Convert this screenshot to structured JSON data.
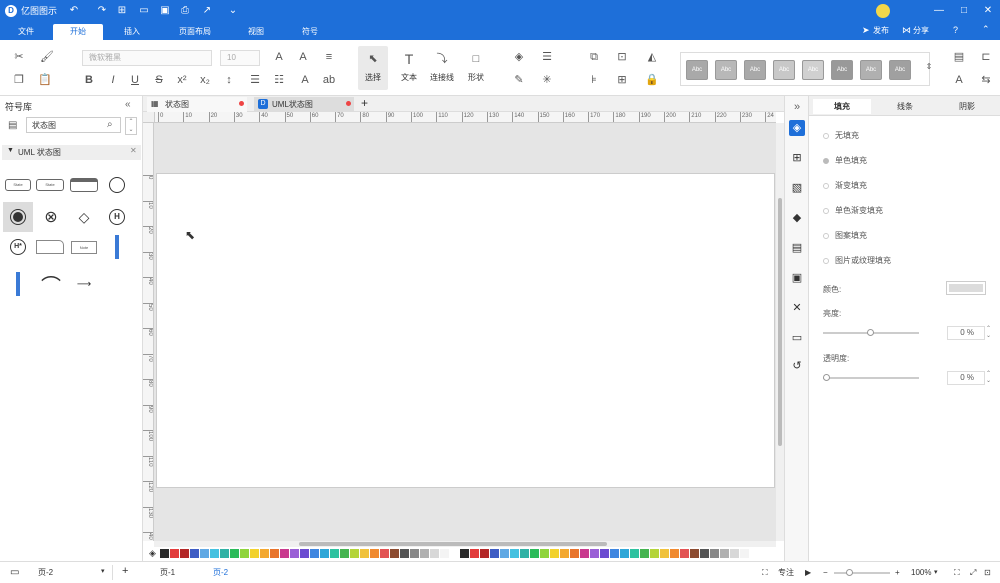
{
  "app": {
    "title": "亿图图示"
  },
  "header": {
    "publish": "发布",
    "share": "分享"
  },
  "menu": {
    "file": "文件",
    "start": "开始",
    "insert": "插入",
    "page_layout": "页面布局",
    "view": "视图",
    "symbol": "符号"
  },
  "ribbon": {
    "font_family": "微软雅黑",
    "font_size": "10",
    "select": "选择",
    "text": "文本",
    "connector": "连接线",
    "shape": "形状",
    "style_label": "Abc"
  },
  "left_panel": {
    "title": "符号库",
    "search_value": "状态图",
    "category": "UML 状态图",
    "shape_label_state": "State",
    "shape_label_note": "Note"
  },
  "doc_tabs": [
    {
      "label": "状态图"
    },
    {
      "label": "UML状态图"
    }
  ],
  "ruler": {
    "h_ticks": [
      "0",
      "10",
      "20",
      "30",
      "40",
      "50",
      "60",
      "70",
      "80",
      "90",
      "100",
      "110",
      "120",
      "130",
      "140",
      "150",
      "160",
      "170",
      "180",
      "190",
      "200",
      "210",
      "220",
      "230",
      "24"
    ],
    "v_ticks": [
      "0",
      "10",
      "20",
      "30",
      "40",
      "50",
      "60",
      "70",
      "80",
      "90",
      "100",
      "110",
      "120",
      "130",
      "40"
    ]
  },
  "right_panel": {
    "tabs": [
      "填充",
      "线条",
      "阴影"
    ],
    "fill_options": [
      "无填充",
      "单色填充",
      "渐变填充",
      "单色渐变填充",
      "图案填充",
      "图片或纹理填充"
    ],
    "color_label": "颜色:",
    "brightness_label": "亮度:",
    "brightness_value": "0 %",
    "transparency_label": "透明度:",
    "transparency_value": "0 %"
  },
  "status": {
    "page_select": "页-2",
    "page1": "页-1",
    "page2": "页-2",
    "focus": "专注",
    "zoom": "100%"
  },
  "colors": {
    "brand": "#1e6fd9",
    "palette": [
      "#2b2b2b",
      "#e23b3b",
      "#b32828",
      "#3e5cc4",
      "#5fa8e4",
      "#44c1e0",
      "#30b2a5",
      "#2bbb5a",
      "#8fd43b",
      "#f2d22e",
      "#f3a830",
      "#e8742c",
      "#c93a8e",
      "#9a5fd6",
      "#6b4cd1",
      "#3f86e0",
      "#2fa7d8",
      "#2ec2a0",
      "#45b450",
      "#b4d43a",
      "#f0c23c",
      "#f08a30",
      "#e25353",
      "#8c4b30",
      "#555555",
      "#888888",
      "#b0b0b0",
      "#d8d8d8",
      "#f4f4f4",
      "#ffffff"
    ]
  }
}
